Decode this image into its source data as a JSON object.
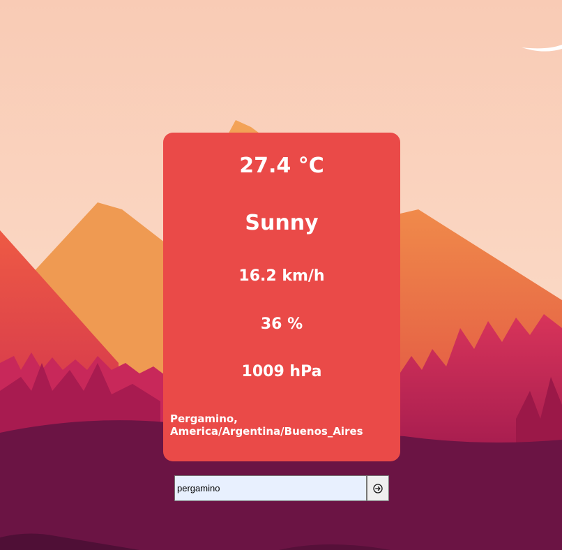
{
  "weather": {
    "temperature": "27.4 °C",
    "condition": "Sunny",
    "wind_speed": "16.2 km/h",
    "humidity": "36 %",
    "pressure": "1009 hPa",
    "location": "Pergamino, America/Argentina/Buenos_Aires"
  },
  "search": {
    "value": "pergamino",
    "button_icon": "arrow-right-circle-icon"
  },
  "colors": {
    "card_background": "#ea4a48",
    "sky": "#f9d0bb",
    "foreground_hills": "#6b1444"
  }
}
